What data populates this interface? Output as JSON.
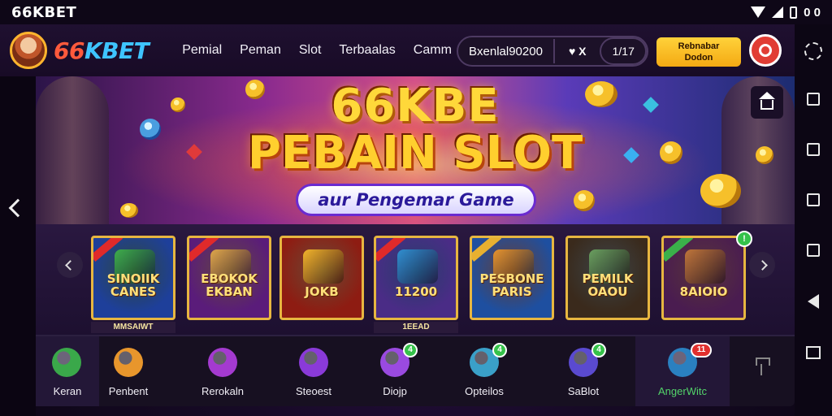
{
  "statusbar": {
    "app_title": "66KBET",
    "time": "0 0"
  },
  "header": {
    "brand_a": "66",
    "brand_b": "KBET",
    "nav": [
      "Pemial",
      "Peman",
      "Slot",
      "Terbaalas",
      "Camm"
    ],
    "balance_amount": "Bxenlal90200",
    "fav_label": "♥ X",
    "count_label": "1/17",
    "cta_line1": "Rebnabar",
    "cta_line2": "Dodon"
  },
  "hero": {
    "line1": "66KBE",
    "line2": "PEBAIN SLOT",
    "ribbon": "aur Pengemar Game"
  },
  "games": [
    {
      "label": "SINOIIK CANES",
      "tag": "MMSAIWT",
      "bg": "#1e3f9a",
      "art": "#3fae4a"
    },
    {
      "label": "EBOKOK EKBAN",
      "tag": "",
      "bg": "#5a1c7a",
      "art": "#e0a84a"
    },
    {
      "label": "JOKB",
      "tag": "",
      "bg": "#8e1c12",
      "art": "#f2b52c"
    },
    {
      "label": "11200",
      "tag": "1EEAD",
      "bg": "#4a2c86",
      "art": "#2f8fd0"
    },
    {
      "label": "PESBONE PARIS",
      "tag": "",
      "bg": "#1e4fa0",
      "art": "#e8932c"
    },
    {
      "label": "PEMILK OAOU",
      "tag": "",
      "bg": "#3a2a1c",
      "art": "#6aa060"
    },
    {
      "label": "8AIOIO",
      "tag": "",
      "bg": "#4a1c50",
      "art": "#c0763a"
    }
  ],
  "tabs": [
    {
      "label": "Keran",
      "icon": "user-plus-icon",
      "color": "#3aa84a",
      "badge": ""
    },
    {
      "label": "Penbent",
      "icon": "treasure-chest-icon",
      "color": "#e8962c",
      "badge": ""
    },
    {
      "label": "Rerokaln",
      "icon": "location-pin-icon",
      "color": "#a43ad0",
      "badge": ""
    },
    {
      "label": "Steoest",
      "icon": "chat-icon",
      "color": "#8a3ad8",
      "badge": ""
    },
    {
      "label": "Diojp",
      "icon": "message-icon",
      "color": "#9a4ae0",
      "badge": "4"
    },
    {
      "label": "Opteilos",
      "icon": "leaf-icon",
      "color": "#3aa0c8",
      "badge": "4"
    },
    {
      "label": "SaBlot",
      "icon": "link-icon",
      "color": "#5a4ad0",
      "badge": "4"
    },
    {
      "label": "AngerWitc",
      "icon": "mailbox-icon",
      "color": "#2a80c0",
      "badge": "11"
    }
  ],
  "colors": {
    "accent": "#ffd23a",
    "brand_red": "#ff5a3c",
    "brand_blue": "#3ec4ff",
    "active_green": "#53d36a"
  }
}
